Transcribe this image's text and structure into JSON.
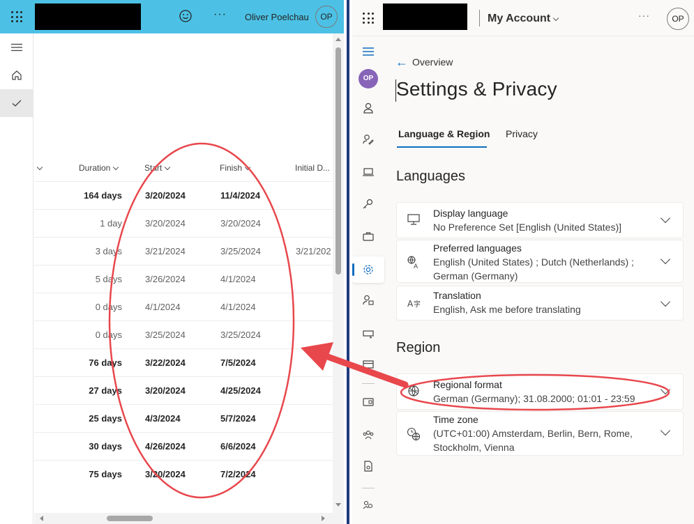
{
  "left_app": {
    "user_name": "Oliver Poelchau",
    "user_initials": "OP",
    "columns": {
      "duration": "Duration",
      "start": "Start",
      "finish": "Finish",
      "initial": "Initial D..."
    },
    "rows": [
      {
        "duration": "164 days",
        "start": "3/20/2024",
        "finish": "11/4/2024",
        "initial": "",
        "bold": true
      },
      {
        "duration": "1 day",
        "start": "3/20/2024",
        "finish": "3/20/2024",
        "initial": "",
        "bold": false
      },
      {
        "duration": "3 days",
        "start": "3/21/2024",
        "finish": "3/25/2024",
        "initial": "3/21/202",
        "bold": false
      },
      {
        "duration": "5 days",
        "start": "3/26/2024",
        "finish": "4/1/2024",
        "initial": "",
        "bold": false
      },
      {
        "duration": "0 days",
        "start": "4/1/2024",
        "finish": "4/1/2024",
        "initial": "",
        "bold": false
      },
      {
        "duration": "0 days",
        "start": "3/25/2024",
        "finish": "3/25/2024",
        "initial": "",
        "bold": false
      },
      {
        "duration": "76 days",
        "start": "3/22/2024",
        "finish": "7/5/2024",
        "initial": "",
        "bold": true
      },
      {
        "duration": "27 days",
        "start": "3/20/2024",
        "finish": "4/25/2024",
        "initial": "",
        "bold": true
      },
      {
        "duration": "25 days",
        "start": "4/3/2024",
        "finish": "5/7/2024",
        "initial": "",
        "bold": true
      },
      {
        "duration": "30 days",
        "start": "4/26/2024",
        "finish": "6/6/2024",
        "initial": "",
        "bold": true
      },
      {
        "duration": "75 days",
        "start": "3/20/2024",
        "finish": "7/2/2024",
        "initial": "",
        "bold": true
      }
    ],
    "header_color": "#4cc1e5"
  },
  "right_app": {
    "app_title": "My Account",
    "user_initials": "OP",
    "back_label": "Overview",
    "page_title": "Settings & Privacy",
    "tabs": [
      "Language & Region",
      "Privacy"
    ],
    "languages_heading": "Languages",
    "region_heading": "Region",
    "cards": {
      "display_language": {
        "title": "Display language",
        "value": "No Preference Set [English (United States)]"
      },
      "preferred_languages": {
        "title": "Preferred languages",
        "value": "English (United States) ; Dutch (Netherlands) ; German (Germany)"
      },
      "translation": {
        "title": "Translation",
        "value": "English, Ask me before translating"
      },
      "regional_format": {
        "title": "Regional format",
        "value": "German (Germany); 31.08.2000; 01:01 - 23:59"
      },
      "time_zone": {
        "title": "Time zone",
        "value": "(UTC+01:00) Amsterdam, Berlin, Bern, Rome, Stockholm, Vienna"
      }
    },
    "accent_color": "#0f6cbd",
    "avatar_color": "#8764b8"
  },
  "annotation_color": "#e8474c"
}
